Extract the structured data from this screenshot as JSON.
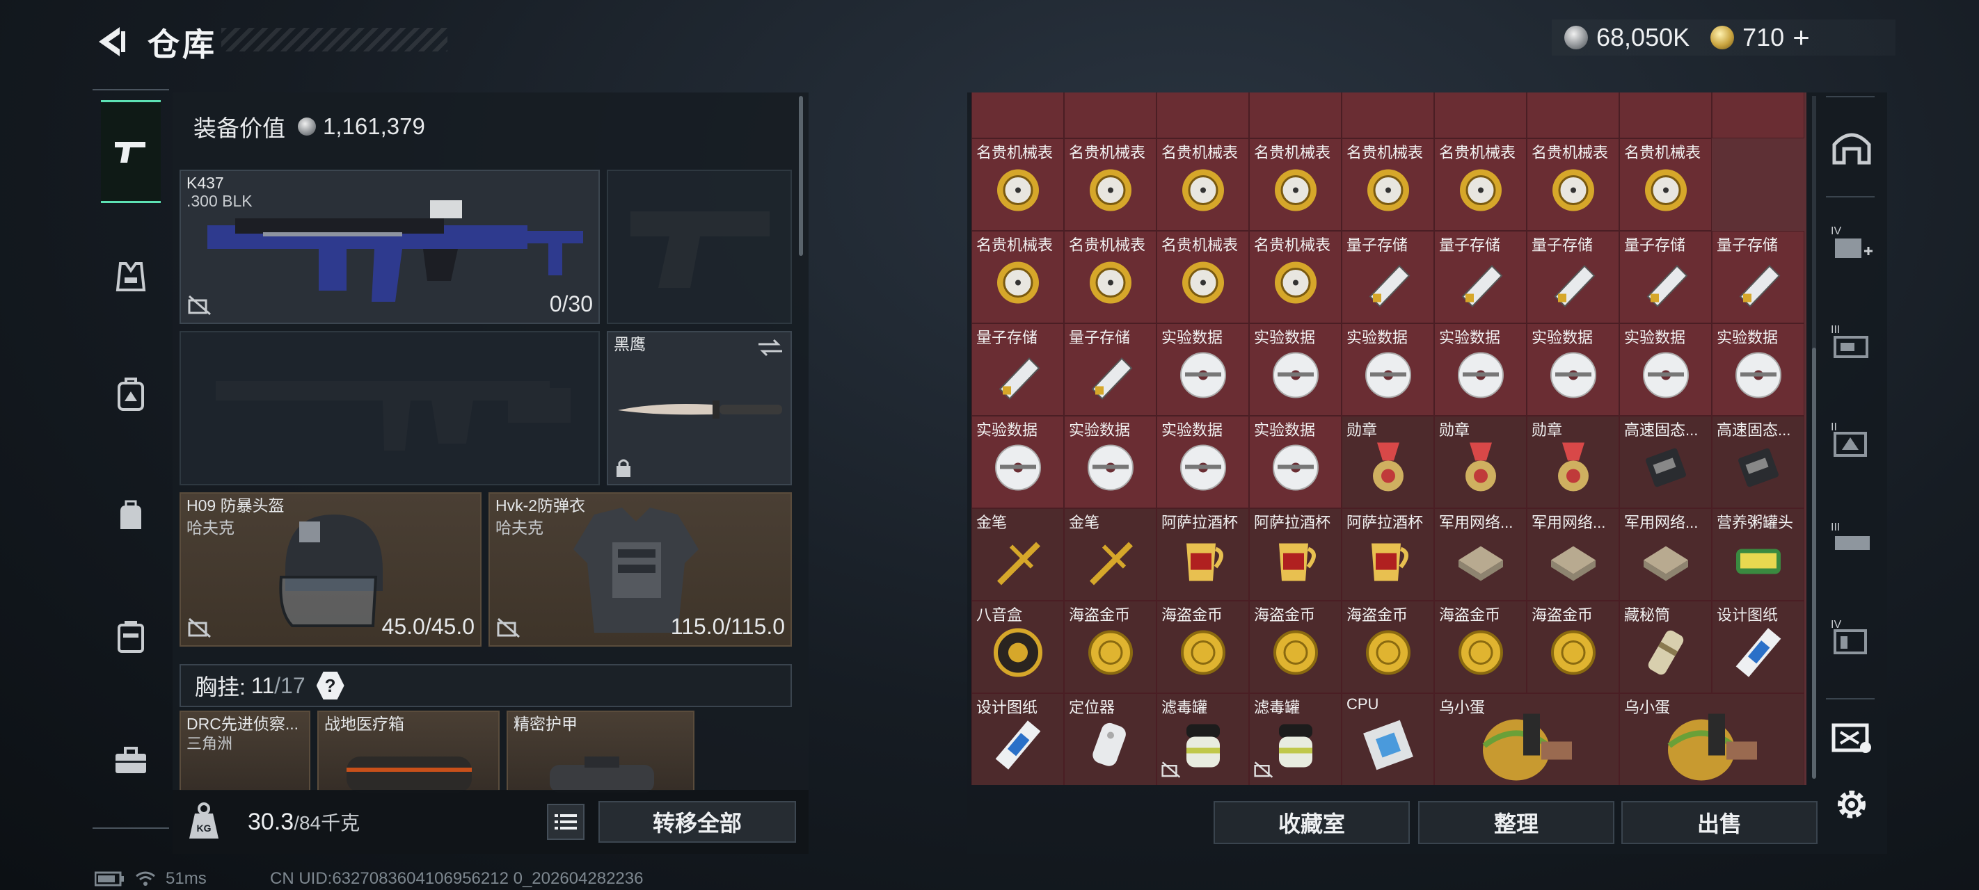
{
  "header": {
    "title": "仓库"
  },
  "currency": {
    "silver": "68,050K",
    "gold": "710",
    "gold_add": "+"
  },
  "left_nav": {
    "items": [
      {
        "name": "weapons",
        "icon": "pistol-icon"
      },
      {
        "name": "vest",
        "icon": "vest-icon"
      },
      {
        "name": "backpack-armor",
        "icon": "pack-icon"
      },
      {
        "name": "bag",
        "icon": "bag-icon"
      },
      {
        "name": "case",
        "icon": "case-icon"
      },
      {
        "name": "toolbox",
        "icon": "toolbox-icon"
      }
    ]
  },
  "equipment": {
    "value_label": "装备价值",
    "value": "1,161,379",
    "primary": {
      "name": "K437",
      "caliber": ".300 BLK",
      "ammo": "0/30"
    },
    "melee": {
      "name": "黑鹰"
    },
    "helmet": {
      "name": "H09 防暴头盔",
      "maker": "哈夫克",
      "durability": "45.0/45.0"
    },
    "armor": {
      "name": "Hvk-2防弹衣",
      "maker": "哈夫克",
      "durability": "115.0/115.0"
    },
    "chest": {
      "label": "胸挂:",
      "count": "11",
      "total": "/17",
      "help": "?"
    },
    "chest_items": [
      {
        "name": "DRC先进侦察...",
        "sub": "三角洲"
      },
      {
        "name": "战地医疗箱",
        "sub": ""
      },
      {
        "name": "精密护甲",
        "sub": ""
      }
    ],
    "weight": {
      "current": "30.3",
      "max": "/84千克"
    },
    "transfer_label": "转移全部"
  },
  "status": {
    "ping": "51ms",
    "uid": "CN UID:6327083604106956212 0_202604282236"
  },
  "inventory": {
    "rows": [
      [
        "名贵机械表",
        "名贵机械表",
        "名贵机械表",
        "名贵机械表",
        "名贵机械表",
        "名贵机械表",
        "名贵机械表",
        "名贵机械表"
      ],
      [
        "名贵机械表",
        "名贵机械表",
        "名贵机械表",
        "名贵机械表",
        "量子存储",
        "量子存储",
        "量子存储",
        "量子存储",
        "量子存储"
      ],
      [
        "量子存储",
        "量子存储",
        "实验数据",
        "实验数据",
        "实验数据",
        "实验数据",
        "实验数据",
        "实验数据",
        "实验数据"
      ],
      [
        "实验数据",
        "实验数据",
        "实验数据",
        "实验数据",
        "勋章",
        "勋章",
        "勋章",
        "高速固态...",
        "高速固态..."
      ],
      [
        "金笔",
        "金笔",
        "阿萨拉酒杯",
        "阿萨拉酒杯",
        "阿萨拉酒杯",
        "军用网络...",
        "军用网络...",
        "军用网络...",
        "营养粥罐头"
      ],
      [
        "八音盒",
        "海盗金币",
        "海盗金币",
        "海盗金币",
        "海盗金币",
        "海盗金币",
        "海盗金币",
        "藏秘筒",
        "设计图纸"
      ],
      [
        "设计图纸",
        "定位器",
        "滤毒罐",
        "滤毒罐",
        "CPU",
        "乌小蛋",
        "乌小蛋"
      ]
    ],
    "buttons": {
      "collection": "收藏室",
      "organize": "整理",
      "sell": "出售"
    }
  },
  "colors": {
    "accent": "#5de2b4",
    "item_bg": "#6a2d33",
    "gold": "#c9a440"
  }
}
